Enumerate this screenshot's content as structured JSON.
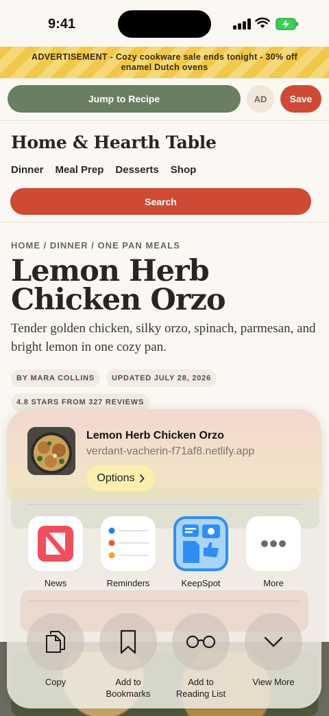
{
  "status_bar": {
    "time": "9:41"
  },
  "ad_banner": {
    "text": "ADVERTISEMENT - Cozy cookware sale ends tonight - 30% off enamel Dutch ovens"
  },
  "sticky_bar": {
    "jump_label": "Jump to Recipe",
    "ad_label": "AD",
    "save_label": "Save"
  },
  "site": {
    "title": "Home & Hearth Table",
    "nav": [
      "Dinner",
      "Meal Prep",
      "Desserts",
      "Shop"
    ],
    "search_label": "Search"
  },
  "article": {
    "breadcrumb": "HOME / DINNER / ONE PAN MEALS",
    "title": "Lemon Herb Chicken Orzo",
    "description": "Tender golden chicken, silky orzo, spinach, parmesan, and bright lemon in one cozy pan.",
    "author": "BY MARA COLLINS",
    "updated": "UPDATED JULY 28, 2026",
    "rating": "4.8 STARS FROM 327 REVIEWS"
  },
  "share_sheet": {
    "title": "Lemon Herb Chicken Orzo",
    "url": "verdant-vacherin-f71af8.netlify.app",
    "options_label": "Options",
    "apps": [
      {
        "label": "News",
        "icon": "news-icon"
      },
      {
        "label": "Reminders",
        "icon": "reminders-icon"
      },
      {
        "label": "KeepSpot",
        "icon": "keepspot-icon"
      },
      {
        "label": "More",
        "icon": "more-icon"
      }
    ],
    "actions": [
      {
        "label": "Copy",
        "icon": "copy-icon"
      },
      {
        "label": "Add to Bookmarks",
        "icon": "bookmark-icon"
      },
      {
        "label": "Add to Reading List",
        "icon": "glasses-icon"
      },
      {
        "label": "View More",
        "icon": "chevron-down-icon"
      }
    ]
  },
  "colors": {
    "accent_red": "#cf4a35",
    "accent_green": "#6a7e62",
    "ad_yellow": "#f1c84c",
    "options_yellow": "#fbefae"
  }
}
